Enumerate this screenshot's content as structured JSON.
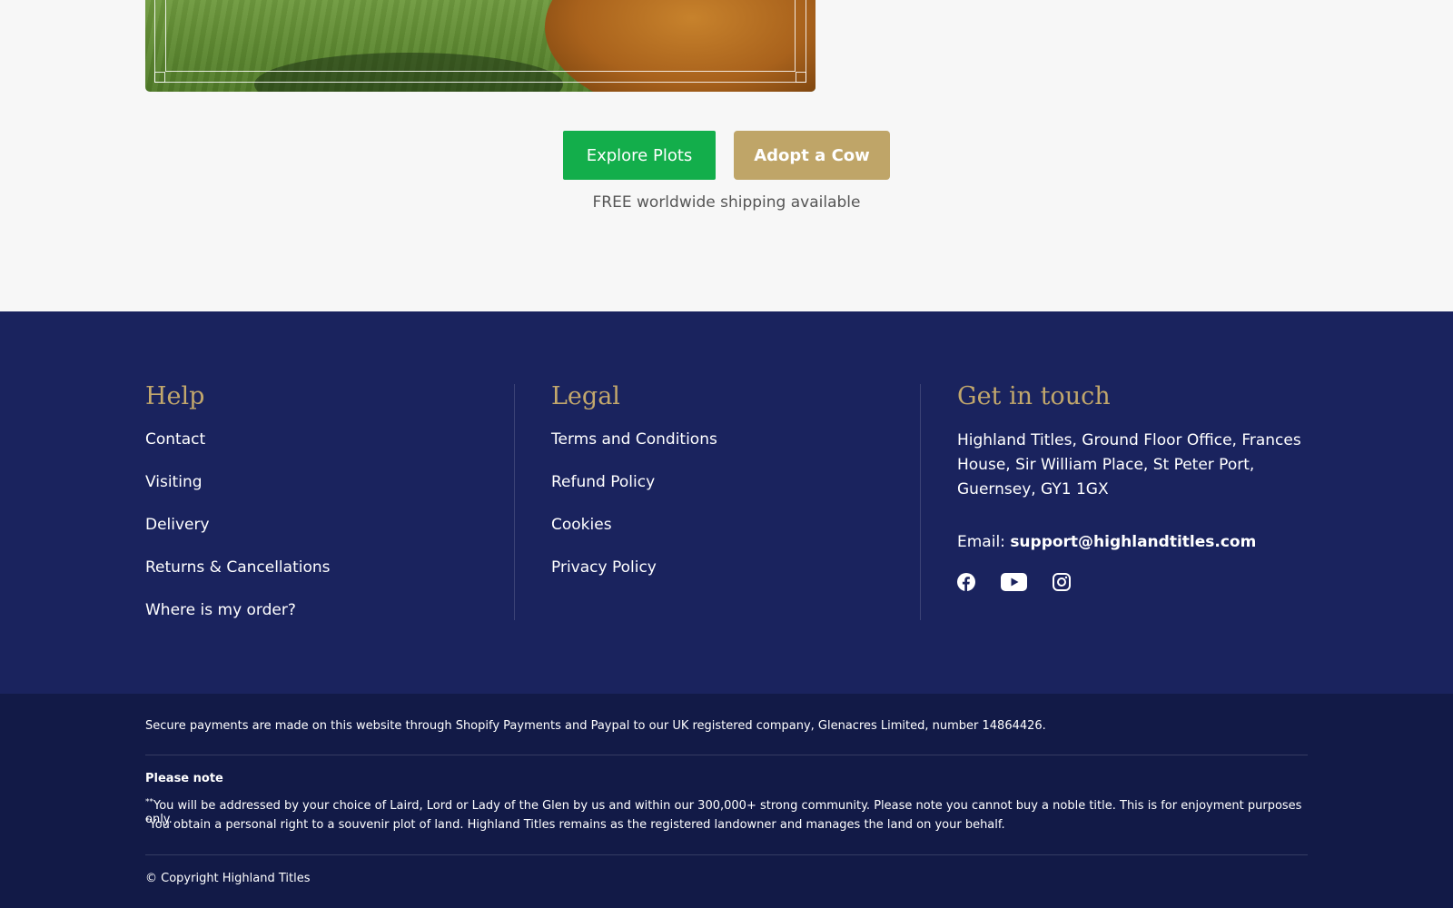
{
  "hero": {
    "explore_label": "Explore Plots",
    "adopt_label": "Adopt a Cow",
    "shipping_text": "FREE worldwide shipping available"
  },
  "footer": {
    "help": {
      "title": "Help",
      "links": [
        "Contact",
        "Visiting",
        "Delivery",
        "Returns & Cancellations",
        "Where is my order?"
      ]
    },
    "legal": {
      "title": "Legal",
      "links": [
        "Terms and Conditions",
        "Refund Policy",
        "Cookies",
        "Privacy Policy"
      ]
    },
    "touch": {
      "title": "Get in touch",
      "address": "Highland Titles, Ground Floor Office, Frances House, Sir William Place, St Peter Port, Guernsey, GY1 1GX",
      "email_label": "Email:",
      "email": "support@highlandtitles.com",
      "social": [
        "facebook-icon",
        "youtube-icon",
        "instagram-icon"
      ]
    }
  },
  "bottom": {
    "secure_text": "Secure payments are made on this website through Shopify Payments and Paypal to our UK registered company, Glenacres Limited, number 14864426.",
    "note_title": "Please note",
    "note1_mark": "**",
    "note1": "You will be addressed by your choice of Laird, Lord or Lady of the Glen by us and within our 300,000+ strong community. Please note you cannot buy a noble title. This is for enjoyment purposes only.",
    "note2_mark": "*",
    "note2": "You obtain a personal right to a souvenir plot of land. Highland Titles remains as the registered landowner and manages the land on your behalf.",
    "copyright": "© Copyright Highland Titles"
  },
  "colors": {
    "green": "#13ae4b",
    "gold": "#bfa568",
    "navy": "#1a235e",
    "navy_dark": "#121a47",
    "heading_gold": "#c2a76c"
  }
}
